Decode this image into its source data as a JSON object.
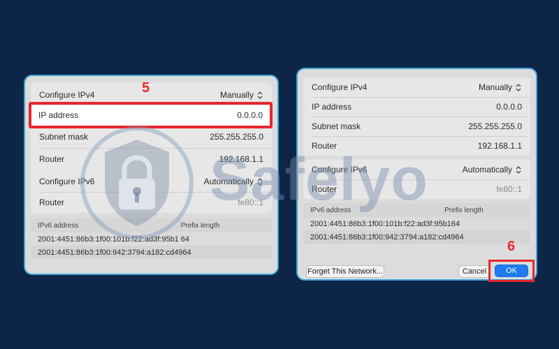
{
  "left": {
    "step": "5",
    "configure_ipv4": {
      "label": "Configure IPv4",
      "value": "Manually"
    },
    "ip_address": {
      "label": "IP address",
      "value": "0.0.0.0"
    },
    "subnet_mask": {
      "label": "Subnet mask",
      "value": "255.255.255.0"
    },
    "router": {
      "label": "Router",
      "value": "192.168.1.1"
    },
    "configure_ipv6": {
      "label": "Configure IPv6",
      "value": "Automatically"
    },
    "router6": {
      "label": "Router",
      "value": "fe80::1"
    },
    "ipv6_table": {
      "headers": [
        "IPv6 address",
        "Prefix length"
      ],
      "rows": [
        [
          "2001:4451:86b3:1f00:101b:f22:ad3f:95b1",
          "64"
        ],
        [
          "2001:4451:86b3:1f00:942:3794:a182:cd49",
          "64"
        ]
      ]
    }
  },
  "right": {
    "step": "6",
    "configure_ipv4": {
      "label": "Configure IPv4",
      "value": "Manually"
    },
    "ip_address": {
      "label": "IP address",
      "value": "0.0.0.0"
    },
    "subnet_mask": {
      "label": "Subnet mask",
      "value": "255.255.255.0"
    },
    "router": {
      "label": "Router",
      "value": "192.168.1.1"
    },
    "configure_ipv6": {
      "label": "Configure IPv6",
      "value": "Automatically"
    },
    "router6": {
      "label": "Router",
      "value": "fe80::1"
    },
    "ipv6_table": {
      "headers": [
        "IPv6 address",
        "Prefix length"
      ],
      "rows": [
        [
          "2001:4451:86b3:1f00:101b:f22:ad3f:95b1",
          "64"
        ],
        [
          "2001:4451:86b3:1f00:942:3794:a182:cd49",
          "64"
        ]
      ]
    },
    "forget_label": "Forget This Network...",
    "cancel_label": "Cancel",
    "ok_label": "OK"
  },
  "watermark": {
    "text": "Safelyo",
    "icon": "shield-lock-icon"
  },
  "colors": {
    "background": "#0d2547",
    "panel_border": "#3fa7d6",
    "highlight": "#e8262d",
    "primary": "#1e7bf0"
  }
}
